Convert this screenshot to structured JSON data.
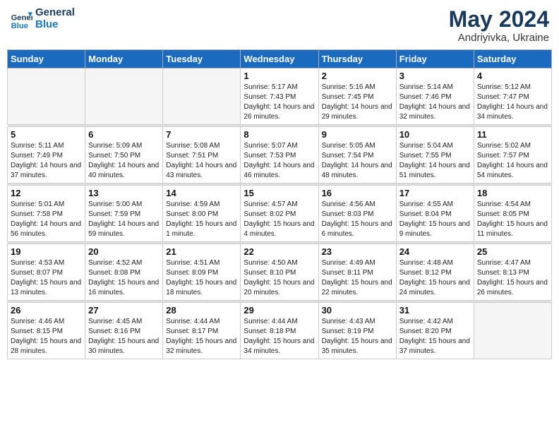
{
  "header": {
    "logo_line1": "General",
    "logo_line2": "Blue",
    "month": "May 2024",
    "location": "Andriyivka, Ukraine"
  },
  "weekdays": [
    "Sunday",
    "Monday",
    "Tuesday",
    "Wednesday",
    "Thursday",
    "Friday",
    "Saturday"
  ],
  "weeks": [
    [
      {
        "day": "",
        "empty": true
      },
      {
        "day": "",
        "empty": true
      },
      {
        "day": "",
        "empty": true
      },
      {
        "day": "1",
        "sunrise": "5:17 AM",
        "sunset": "7:43 PM",
        "daylight": "14 hours and 26 minutes."
      },
      {
        "day": "2",
        "sunrise": "5:16 AM",
        "sunset": "7:45 PM",
        "daylight": "14 hours and 29 minutes."
      },
      {
        "day": "3",
        "sunrise": "5:14 AM",
        "sunset": "7:46 PM",
        "daylight": "14 hours and 32 minutes."
      },
      {
        "day": "4",
        "sunrise": "5:12 AM",
        "sunset": "7:47 PM",
        "daylight": "14 hours and 34 minutes."
      }
    ],
    [
      {
        "day": "5",
        "sunrise": "5:11 AM",
        "sunset": "7:49 PM",
        "daylight": "14 hours and 37 minutes."
      },
      {
        "day": "6",
        "sunrise": "5:09 AM",
        "sunset": "7:50 PM",
        "daylight": "14 hours and 40 minutes."
      },
      {
        "day": "7",
        "sunrise": "5:08 AM",
        "sunset": "7:51 PM",
        "daylight": "14 hours and 43 minutes."
      },
      {
        "day": "8",
        "sunrise": "5:07 AM",
        "sunset": "7:53 PM",
        "daylight": "14 hours and 46 minutes."
      },
      {
        "day": "9",
        "sunrise": "5:05 AM",
        "sunset": "7:54 PM",
        "daylight": "14 hours and 48 minutes."
      },
      {
        "day": "10",
        "sunrise": "5:04 AM",
        "sunset": "7:55 PM",
        "daylight": "14 hours and 51 minutes."
      },
      {
        "day": "11",
        "sunrise": "5:02 AM",
        "sunset": "7:57 PM",
        "daylight": "14 hours and 54 minutes."
      }
    ],
    [
      {
        "day": "12",
        "sunrise": "5:01 AM",
        "sunset": "7:58 PM",
        "daylight": "14 hours and 56 minutes."
      },
      {
        "day": "13",
        "sunrise": "5:00 AM",
        "sunset": "7:59 PM",
        "daylight": "14 hours and 59 minutes."
      },
      {
        "day": "14",
        "sunrise": "4:59 AM",
        "sunset": "8:00 PM",
        "daylight": "15 hours and 1 minute."
      },
      {
        "day": "15",
        "sunrise": "4:57 AM",
        "sunset": "8:02 PM",
        "daylight": "15 hours and 4 minutes."
      },
      {
        "day": "16",
        "sunrise": "4:56 AM",
        "sunset": "8:03 PM",
        "daylight": "15 hours and 6 minutes."
      },
      {
        "day": "17",
        "sunrise": "4:55 AM",
        "sunset": "8:04 PM",
        "daylight": "15 hours and 9 minutes."
      },
      {
        "day": "18",
        "sunrise": "4:54 AM",
        "sunset": "8:05 PM",
        "daylight": "15 hours and 11 minutes."
      }
    ],
    [
      {
        "day": "19",
        "sunrise": "4:53 AM",
        "sunset": "8:07 PM",
        "daylight": "15 hours and 13 minutes."
      },
      {
        "day": "20",
        "sunrise": "4:52 AM",
        "sunset": "8:08 PM",
        "daylight": "15 hours and 16 minutes."
      },
      {
        "day": "21",
        "sunrise": "4:51 AM",
        "sunset": "8:09 PM",
        "daylight": "15 hours and 18 minutes."
      },
      {
        "day": "22",
        "sunrise": "4:50 AM",
        "sunset": "8:10 PM",
        "daylight": "15 hours and 20 minutes."
      },
      {
        "day": "23",
        "sunrise": "4:49 AM",
        "sunset": "8:11 PM",
        "daylight": "15 hours and 22 minutes."
      },
      {
        "day": "24",
        "sunrise": "4:48 AM",
        "sunset": "8:12 PM",
        "daylight": "15 hours and 24 minutes."
      },
      {
        "day": "25",
        "sunrise": "4:47 AM",
        "sunset": "8:13 PM",
        "daylight": "15 hours and 26 minutes."
      }
    ],
    [
      {
        "day": "26",
        "sunrise": "4:46 AM",
        "sunset": "8:15 PM",
        "daylight": "15 hours and 28 minutes."
      },
      {
        "day": "27",
        "sunrise": "4:45 AM",
        "sunset": "8:16 PM",
        "daylight": "15 hours and 30 minutes."
      },
      {
        "day": "28",
        "sunrise": "4:44 AM",
        "sunset": "8:17 PM",
        "daylight": "15 hours and 32 minutes."
      },
      {
        "day": "29",
        "sunrise": "4:44 AM",
        "sunset": "8:18 PM",
        "daylight": "15 hours and 34 minutes."
      },
      {
        "day": "30",
        "sunrise": "4:43 AM",
        "sunset": "8:19 PM",
        "daylight": "15 hours and 35 minutes."
      },
      {
        "day": "31",
        "sunrise": "4:42 AM",
        "sunset": "8:20 PM",
        "daylight": "15 hours and 37 minutes."
      },
      {
        "day": "",
        "empty": true
      }
    ]
  ]
}
